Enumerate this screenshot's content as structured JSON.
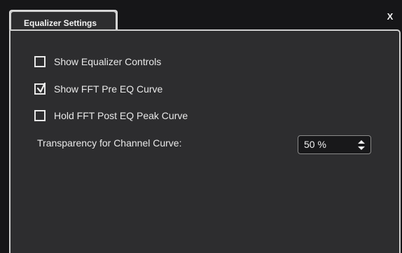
{
  "window": {
    "tab_label": "Equalizer Settings",
    "close_label": "X"
  },
  "options": [
    {
      "label": "Show Equalizer Controls",
      "checked": false
    },
    {
      "label": "Show FFT Pre EQ Curve",
      "checked": true
    },
    {
      "label": "Hold FFT Post EQ Peak Curve",
      "checked": false
    }
  ],
  "transparency": {
    "label": "Transparency for Channel Curve:",
    "value": "50 %"
  },
  "icons": {
    "checkmark": "checkmark-icon",
    "spin_arrows": "up-down-arrow-icon",
    "close": "close-icon"
  },
  "colors": {
    "window_bg": "#161618",
    "panel_bg": "#2d2d2f",
    "border": "#cfcfcf",
    "text": "#e9e9e9"
  }
}
